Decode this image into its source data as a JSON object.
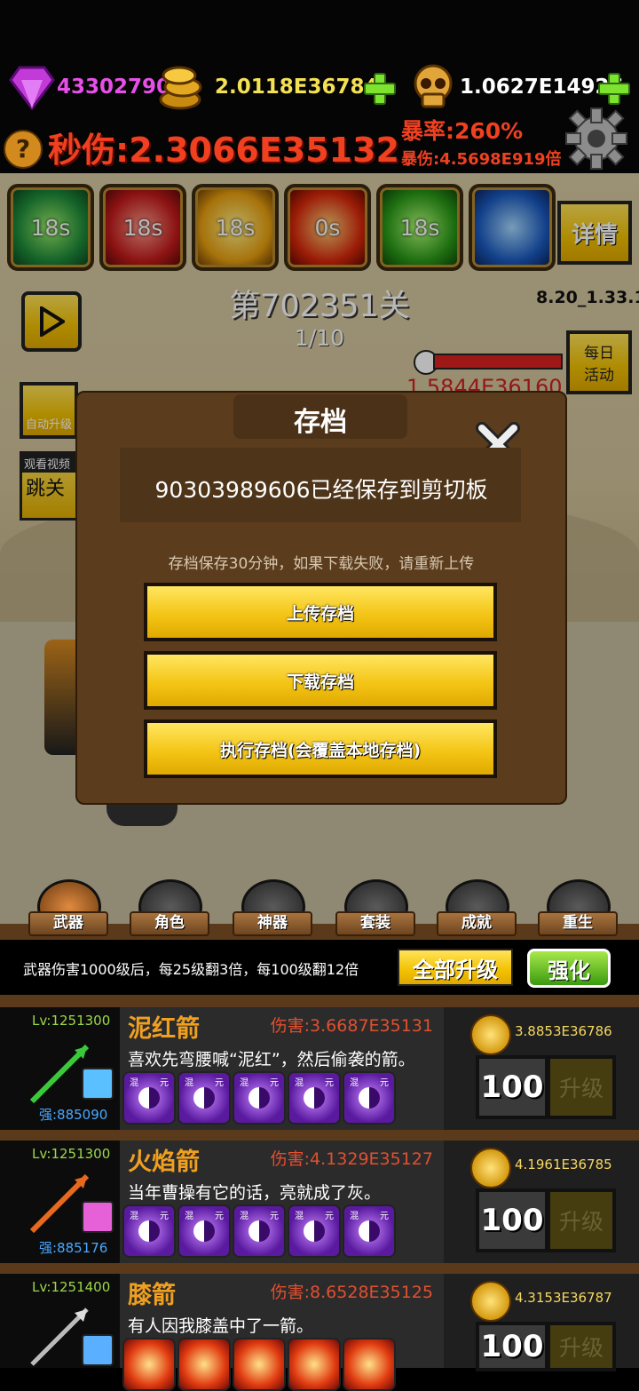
{
  "resources": {
    "gems": "43302790",
    "gold": "2.0118E36784",
    "skulls": "1.0627E14926"
  },
  "stats": {
    "dps_label": "秒伤:2.3066E35132",
    "crit_rate": "暴率:260%",
    "crit_damage": "暴伤:4.5698E919倍"
  },
  "skills": [
    "18s",
    "18s",
    "18s",
    "0s",
    "18s",
    ""
  ],
  "buttons": {
    "details": "详情",
    "daily": "每日\n活动",
    "auto_upgrade": "自动升级",
    "watch_video": "观看视频",
    "skip_level": "跳关"
  },
  "level": {
    "title": "第702351关",
    "progress": "1/10",
    "version": "8.20_1.33.1",
    "enemy_hp": "1.5844E36160"
  },
  "modal": {
    "title": "存档",
    "message": "90303989606已经保存到剪切板",
    "note": "存档保存30分钟，如果下载失败，请重新上传",
    "upload": "上传存档",
    "download": "下载存档",
    "execute": "执行存档(会覆盖本地存档)"
  },
  "tabs": [
    "武器",
    "角色",
    "神器",
    "套装",
    "成就",
    "重生"
  ],
  "weapon_bar": {
    "info": "武器伤害1000级后，每25级翻3倍，每100级翻12倍",
    "upgrade_all": "全部升级",
    "enhance": "强化"
  },
  "weapons": [
    {
      "lv": "Lv:1251300",
      "name": "泥红箭",
      "damage": "伤害:3.6687E35131",
      "desc": "喜欢先弯腰喊“泥红”，然后偷袭的箭。",
      "strength": "强:885090",
      "cost": "3.8853E36786",
      "qty": "100",
      "upgrade": "升级",
      "gem_type": "yin-yang"
    },
    {
      "lv": "Lv:1251300",
      "name": "火焰箭",
      "damage": "伤害:4.1329E35127",
      "desc": "当年曹操有它的话，亮就成了灰。",
      "strength": "强:885176",
      "cost": "4.1961E36785",
      "qty": "100",
      "upgrade": "升级",
      "gem_type": "yin-yang"
    },
    {
      "lv": "Lv:1251400",
      "name": "膝箭",
      "damage": "伤害:8.6528E35125",
      "desc": "有人因我膝盖中了一箭。",
      "strength": "",
      "cost": "4.3153E36787",
      "qty": "100",
      "upgrade": "升级",
      "gem_type": "fire"
    }
  ],
  "gem_labels": [
    "混",
    "元"
  ]
}
